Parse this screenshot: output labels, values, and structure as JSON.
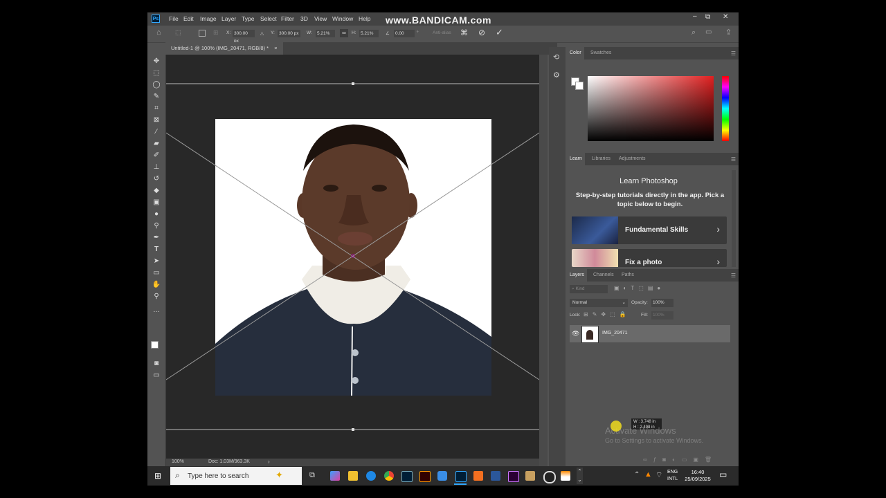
{
  "watermark": "www.BANDICAM.com",
  "app": {
    "logo": "Ps"
  },
  "menu": [
    "File",
    "Edit",
    "Image",
    "Layer",
    "Type",
    "Select",
    "Filter",
    "3D",
    "View",
    "Window",
    "Help"
  ],
  "options": {
    "x_label": "X:",
    "x_value": "300.00 px",
    "y_label": "Y:",
    "y_value": "300.00 px",
    "w_label": "W:",
    "w_value": "5.21%",
    "h_label": "H:",
    "h_value": "5.21%",
    "angle_value": "0.00",
    "angle_unit": "°",
    "interp": "Anti-alias"
  },
  "document": {
    "tab_title": "Untitled-1 @ 100% (IMG_20471, RGB/8) *",
    "close": "×"
  },
  "status": {
    "zoom": "100%",
    "doc": "Doc: 1.03M/963.3K",
    "arrow": "›"
  },
  "panels": {
    "color_tabs": [
      "Color",
      "Swatches"
    ],
    "learn_tabs": [
      "Learn",
      "Libraries",
      "Adjustments"
    ],
    "learn_title": "Learn Photoshop",
    "learn_desc": "Step-by-step tutorials directly in the app. Pick a topic below to begin.",
    "cards": [
      {
        "label": "Fundamental Skills"
      },
      {
        "label": "Fix a photo"
      }
    ],
    "layer_tabs": [
      "Layers",
      "Channels",
      "Paths"
    ],
    "kind_placeholder": "Kind",
    "blend_mode": "Normal",
    "opacity_label": "Opacity:",
    "opacity_value": "100%",
    "lock_label": "Lock:",
    "fill_label": "Fill:",
    "fill_value": "100%",
    "layer_name": "IMG_20471"
  },
  "tooltip": {
    "w": "W :  3.748 in",
    "h": "H :  2.498 in"
  },
  "activate": {
    "title": "Activate Windows",
    "sub": "Go to Settings to activate Windows."
  },
  "taskbar": {
    "search_placeholder": "Type here to search",
    "lang1": "ENG",
    "lang2": "INTL",
    "time": "16:40",
    "date": "25/09/2025"
  },
  "colors": {
    "accent": "#31a8ff",
    "canvas": "#282828",
    "ui": "#535353"
  }
}
